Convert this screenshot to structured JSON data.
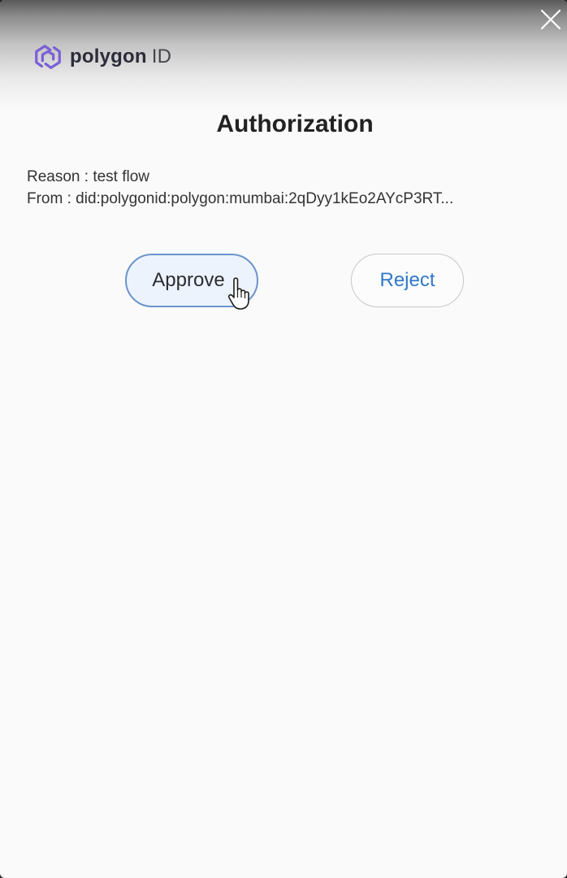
{
  "window": {
    "close_icon": "close-icon"
  },
  "brand": {
    "name": "polygon",
    "suffix": "ID",
    "logo_icon": "polygon-logo-icon",
    "color": "#7b5fd6"
  },
  "dialog": {
    "title": "Authorization",
    "reason": "Reason : test flow",
    "from": "From : did:polygonid:polygon:mumbai:2qDyy1kEo2AYcP3RT..."
  },
  "actions": {
    "approve_label": "Approve",
    "reject_label": "Reject",
    "accent_color": "#2f78c8"
  },
  "pointer": {
    "icon": "hand-pointer-icon"
  }
}
